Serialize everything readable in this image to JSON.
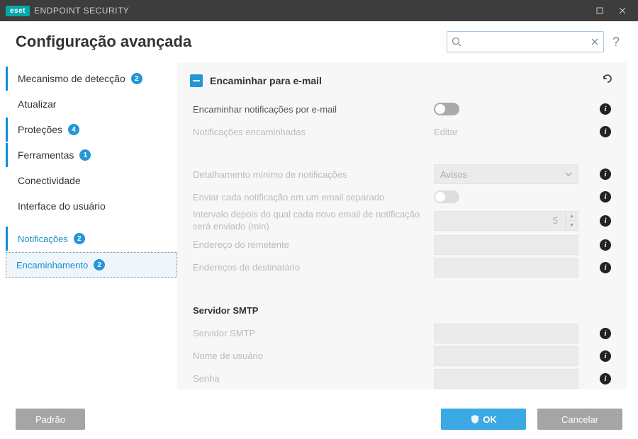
{
  "titlebar": {
    "brand": "eset",
    "product": "ENDPOINT SECURITY"
  },
  "page_title": "Configuração avançada",
  "search": {
    "placeholder": ""
  },
  "sidebar": {
    "items": [
      {
        "label": "Mecanismo de detecção",
        "badge": "2",
        "active": true
      },
      {
        "label": "Atualizar"
      },
      {
        "label": "Proteções",
        "badge": "4",
        "active": true
      },
      {
        "label": "Ferramentas",
        "badge": "1",
        "active": true
      },
      {
        "label": "Conectividade"
      },
      {
        "label": "Interface do usuário"
      }
    ],
    "sub": [
      {
        "label": "Notificações",
        "badge": "2"
      },
      {
        "label": "Encaminhamento",
        "badge": "2",
        "selected": true
      }
    ]
  },
  "section": {
    "title": "Encaminhar para e-mail",
    "rows": {
      "forward_by_email": "Encaminhar notificações por e-mail",
      "forwarded": "Notificações encaminhadas",
      "edit": "Editar",
      "min_detail": "Detalhamento mínimo de notificações",
      "min_detail_value": "Avisos",
      "separate_email": "Enviar cada notificação em um email separado",
      "interval": "Intervalo depois do qual cada novo email de notificação será enviado (min)",
      "interval_value": "5",
      "sender": "Endereço do remetente",
      "recipients": "Endereços de destinatário"
    },
    "smtp": {
      "title": "Servidor SMTP",
      "server": "Servidor SMTP",
      "username": "Nome de usuário",
      "password": "Senha"
    }
  },
  "buttons": {
    "default": "Padrão",
    "ok": "OK",
    "cancel": "Cancelar"
  },
  "icons": {
    "info": "i"
  }
}
